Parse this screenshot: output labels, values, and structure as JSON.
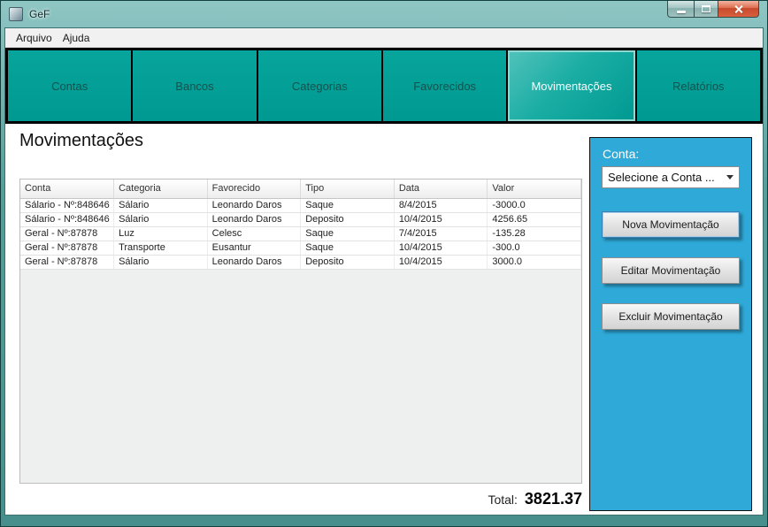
{
  "window": {
    "title": "GeF"
  },
  "menu": {
    "items": [
      {
        "label": "Arquivo"
      },
      {
        "label": "Ajuda"
      }
    ]
  },
  "nav": {
    "tabs": [
      {
        "label": "Contas",
        "active": false
      },
      {
        "label": "Bancos",
        "active": false
      },
      {
        "label": "Categorias",
        "active": false
      },
      {
        "label": "Favorecidos",
        "active": false
      },
      {
        "label": "Movimentações",
        "active": true
      },
      {
        "label": "Relatórios",
        "active": false
      }
    ]
  },
  "main": {
    "heading": "Movimentações",
    "table": {
      "columns": [
        "Conta",
        "Categoria",
        "Favorecido",
        "Tipo",
        "Data",
        "Valor"
      ],
      "rows": [
        [
          "Sálario - Nº:848646",
          "Sálario",
          "Leonardo Daros",
          "Saque",
          "8/4/2015",
          "-3000.0"
        ],
        [
          "Sálario - Nº:848646",
          "Sálario",
          "Leonardo Daros",
          "Deposito",
          "10/4/2015",
          "4256.65"
        ],
        [
          "Geral - Nº:87878",
          "Luz",
          "Celesc",
          "Saque",
          "7/4/2015",
          "-135.28"
        ],
        [
          "Geral - Nº:87878",
          "Transporte",
          "Eusantur",
          "Saque",
          "10/4/2015",
          "-300.0"
        ],
        [
          "Geral - Nº:87878",
          "Sálario",
          "Leonardo Daros",
          "Deposito",
          "10/4/2015",
          "3000.0"
        ]
      ]
    },
    "total_label": "Total:",
    "total_value": "3821.37"
  },
  "sidebar": {
    "conta_label": "Conta:",
    "select_value": "Selecione a Conta ...",
    "buttons": [
      {
        "label": "Nova Movimentação"
      },
      {
        "label": "Editar Movimentação"
      },
      {
        "label": "Excluir Movimentação"
      }
    ]
  },
  "colors": {
    "nav_teal": "#009991",
    "nav_bar_bg": "#000000",
    "sidebar_blue": "#2ea9d8",
    "close_button_red": "#c74a2c",
    "title_frame_teal": "#579e9b"
  }
}
